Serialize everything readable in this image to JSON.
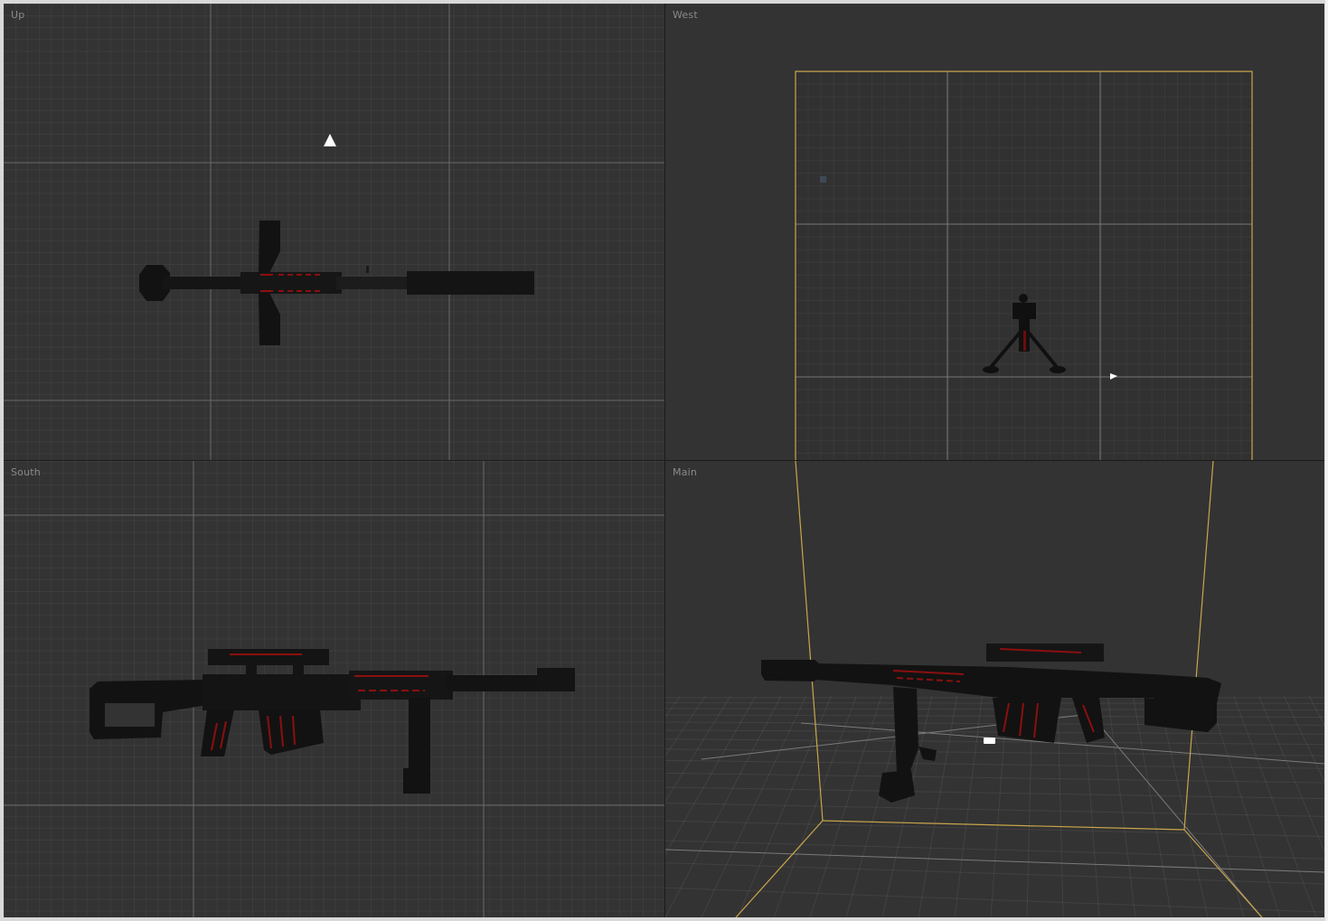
{
  "viewports": {
    "up": {
      "label": "Up"
    },
    "west": {
      "label": "West"
    },
    "south": {
      "label": "South"
    },
    "main": {
      "label": "Main"
    }
  },
  "colors": {
    "viewport_bg": "#333333",
    "grid_major": "#6a6a6a",
    "bounds_outline": "#c9a64a",
    "model_body": "#111111",
    "model_accent": "#8b0f0f"
  },
  "icons": {
    "camera_marker": "triangle-up",
    "light_marker": "small-square",
    "cursor_marker": "pointer"
  }
}
